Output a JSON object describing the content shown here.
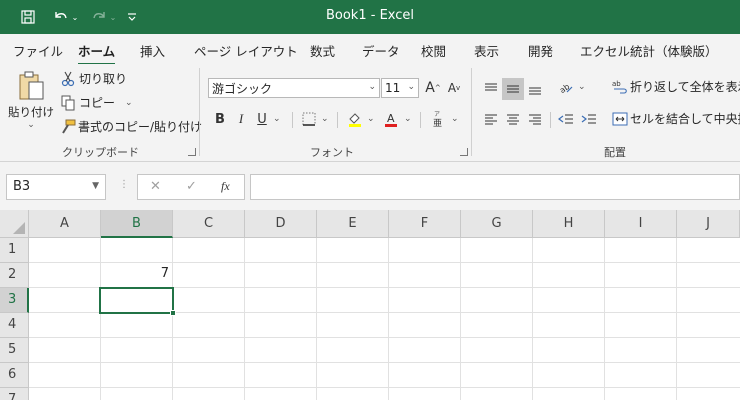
{
  "window": {
    "title": "Book1  -  Excel"
  },
  "quick_access": {
    "save_icon": "save-icon",
    "undo_icon": "undo-icon",
    "redo_icon": "redo-icon",
    "customize_icon": "customize-icon"
  },
  "tabs": [
    {
      "label": "ファイル"
    },
    {
      "label": "ホーム"
    },
    {
      "label": "挿入"
    },
    {
      "label": "ページ レイアウト"
    },
    {
      "label": "数式"
    },
    {
      "label": "データ"
    },
    {
      "label": "校閲"
    },
    {
      "label": "表示"
    },
    {
      "label": "開発"
    },
    {
      "label": "エクセル統計（体験版）"
    }
  ],
  "ribbon": {
    "clipboard": {
      "paste_label": "貼り付け",
      "cut_label": "切り取り",
      "copy_label": "コピー",
      "format_painter_label": "書式のコピー/貼り付け",
      "group_label": "クリップボード"
    },
    "font": {
      "font_name": "游ゴシック",
      "font_size": "11",
      "bold": "B",
      "italic": "I",
      "underline": "U",
      "group_label": "フォント"
    },
    "alignment": {
      "wrap_text_label": "折り返して全体を表示す",
      "merge_center_label": "セルを結合して中央揃え",
      "group_label": "配置"
    }
  },
  "formula_bar": {
    "name_box": "B3",
    "cancel": "✕",
    "enter": "✓",
    "fx": "fx",
    "formula": ""
  },
  "grid": {
    "columns": [
      "A",
      "B",
      "C",
      "D",
      "E",
      "F",
      "G",
      "H",
      "I",
      "J"
    ],
    "rows": [
      "1",
      "2",
      "3",
      "4",
      "5",
      "6",
      "7"
    ],
    "active_column": "B",
    "active_row": "3",
    "cells": {
      "B2": "7"
    }
  },
  "colors": {
    "accent": "#217346"
  }
}
